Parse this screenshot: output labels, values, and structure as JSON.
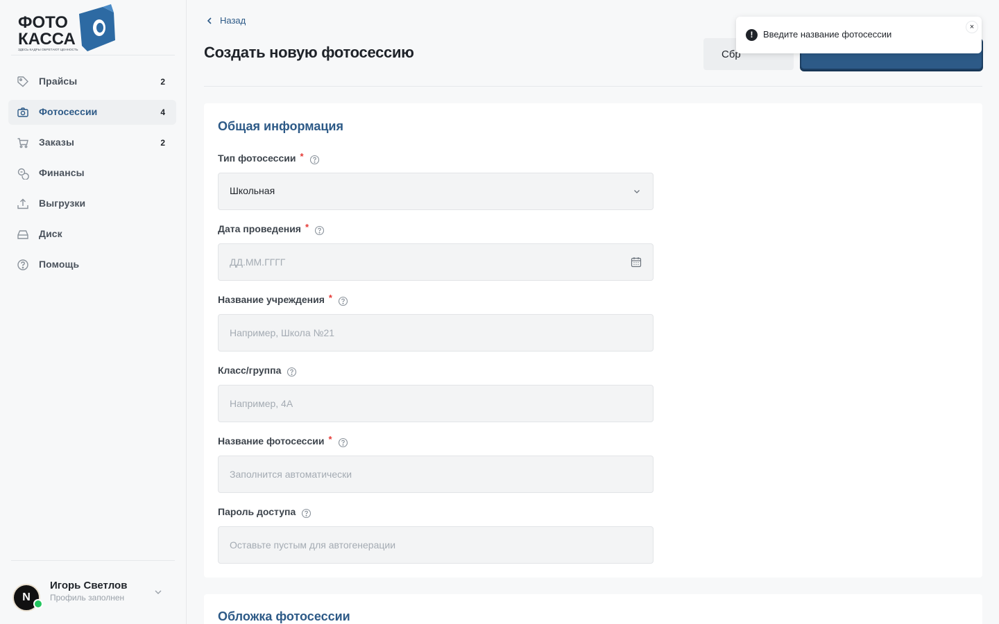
{
  "brand": {
    "logo_line1": "ФОТО",
    "logo_line2": "КАССА",
    "tagline": "ЗДЕСЬ КАДРЫ ОБРЕТАЮТ ЦЕННОСТЬ",
    "accent_color": "#2d5a87"
  },
  "sidebar": {
    "items": [
      {
        "label": "Прайсы",
        "count": "2",
        "icon": "price-tag-icon"
      },
      {
        "label": "Фотосессии",
        "count": "4",
        "icon": "camera-icon",
        "active": true
      },
      {
        "label": "Заказы",
        "count": "2",
        "icon": "shopping-cart-icon"
      },
      {
        "label": "Финансы",
        "count": "",
        "icon": "coins-icon"
      },
      {
        "label": "Выгрузки",
        "count": "",
        "icon": "upload-icon"
      },
      {
        "label": "Диск",
        "count": "",
        "icon": "hard-drive-icon"
      },
      {
        "label": "Помощь",
        "count": "",
        "icon": "help-circle-icon"
      }
    ]
  },
  "profile": {
    "name": "Игорь Светлов",
    "status": "Профиль заполнен",
    "avatar_letter": "N"
  },
  "header": {
    "back_label": "Назад",
    "title": "Создать новую фотосессию",
    "reset_label": "Сбр"
  },
  "form": {
    "section_title": "Общая информация",
    "type": {
      "label": "Тип фотосессии",
      "value": "Школьная"
    },
    "date": {
      "label": "Дата проведения",
      "placeholder": "ДД.ММ.ГГГГ"
    },
    "institution": {
      "label": "Название учреждения",
      "placeholder": "Например, Школа №21"
    },
    "group": {
      "label": "Класс/группа",
      "placeholder": "Например, 4А"
    },
    "session_name": {
      "label": "Название фотосессии",
      "placeholder": "Заполнится автоматически"
    },
    "password": {
      "label": "Пароль доступа",
      "placeholder": "Оставьте пустым для автогенерации"
    },
    "required_mark": "*"
  },
  "cover": {
    "section_title": "Обложка фотосессии"
  },
  "toast": {
    "message": "Введите название фотосессии",
    "close_glyph": "×",
    "icon_glyph": "!"
  }
}
